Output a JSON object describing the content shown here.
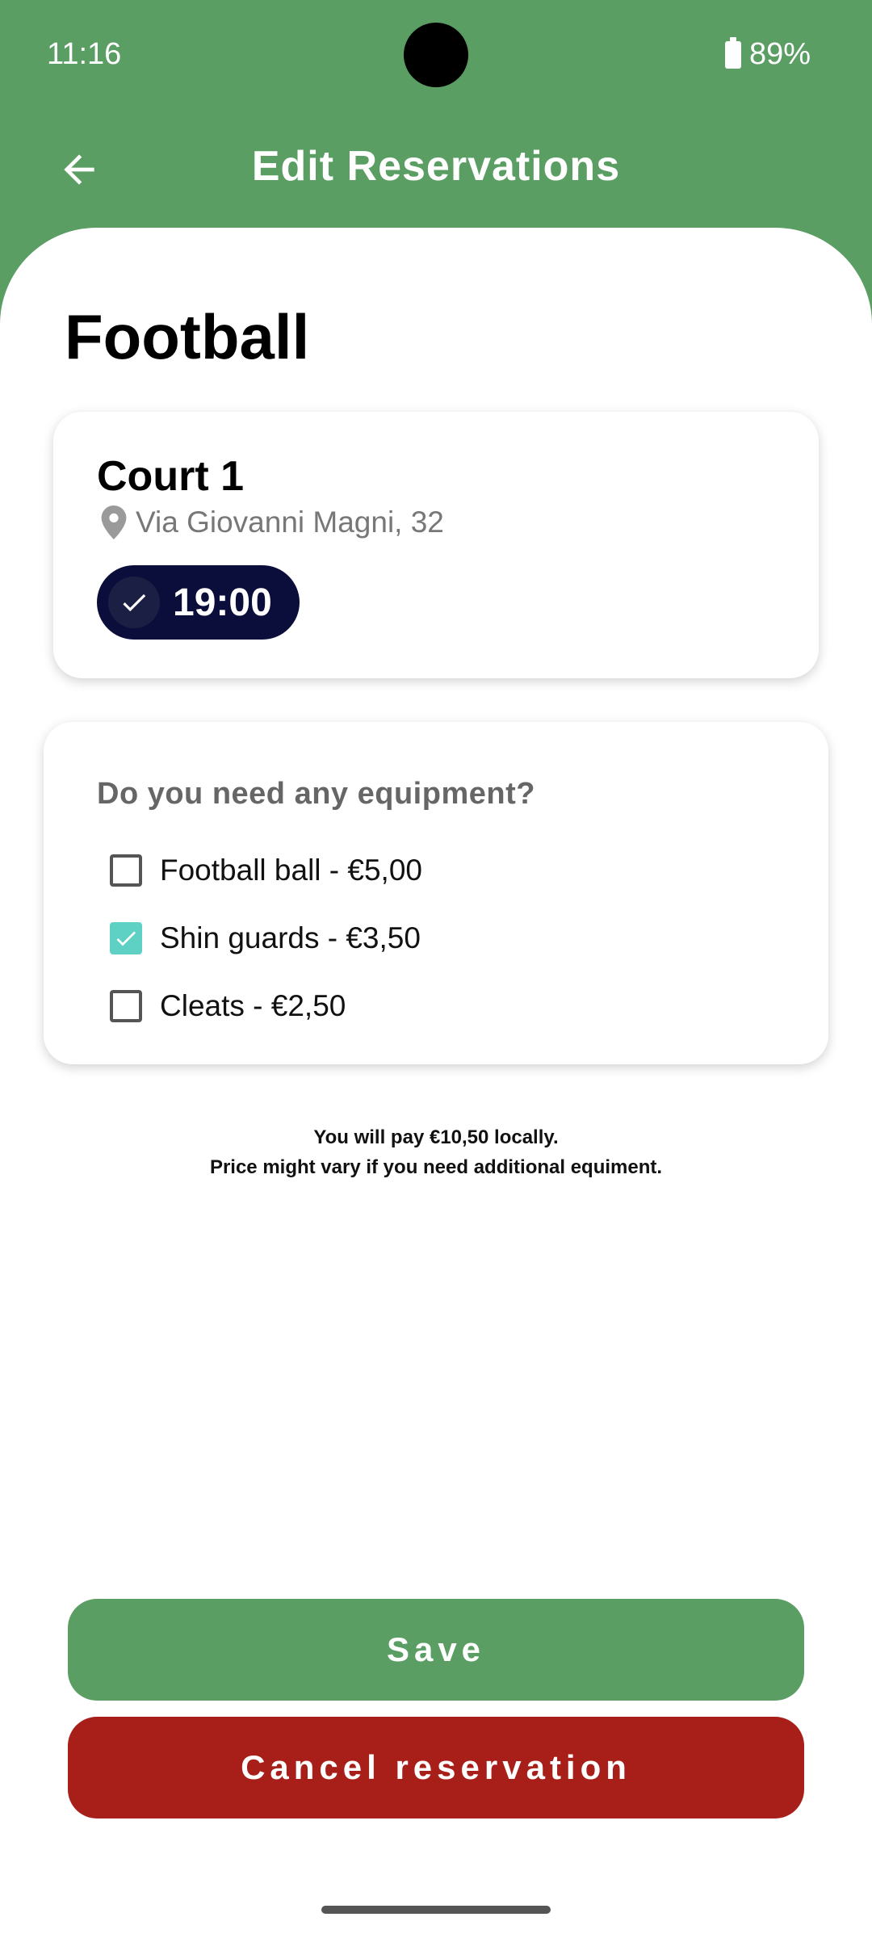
{
  "status_bar": {
    "time": "11:16",
    "battery": "89%"
  },
  "app_bar": {
    "title": "Edit Reservations"
  },
  "sport": {
    "title": "Football"
  },
  "court": {
    "name": "Court 1",
    "address": "Via Giovanni Magni, 32",
    "time_chip": "19:00",
    "time_selected": true
  },
  "equipment": {
    "question": "Do you need any equipment?",
    "items": [
      {
        "label": "Football ball - €5,00",
        "checked": false
      },
      {
        "label": "Shin guards - €3,50",
        "checked": true
      },
      {
        "label": "Cleats - €2,50",
        "checked": false
      }
    ]
  },
  "price_note": {
    "line1": "You will pay €10,50 locally.",
    "line2": "Price might vary if you need additional equiment."
  },
  "actions": {
    "save": "Save",
    "cancel": "Cancel reservation"
  },
  "colors": {
    "primary_green": "#5a9e63",
    "cancel_red": "#a81f1a",
    "chip_navy": "#0b0e3a",
    "checkbox_teal": "#5fd1c4"
  },
  "icons": {
    "back": "arrow-left-icon",
    "location": "location-pin-icon",
    "check": "check-icon",
    "battery": "battery-icon"
  }
}
